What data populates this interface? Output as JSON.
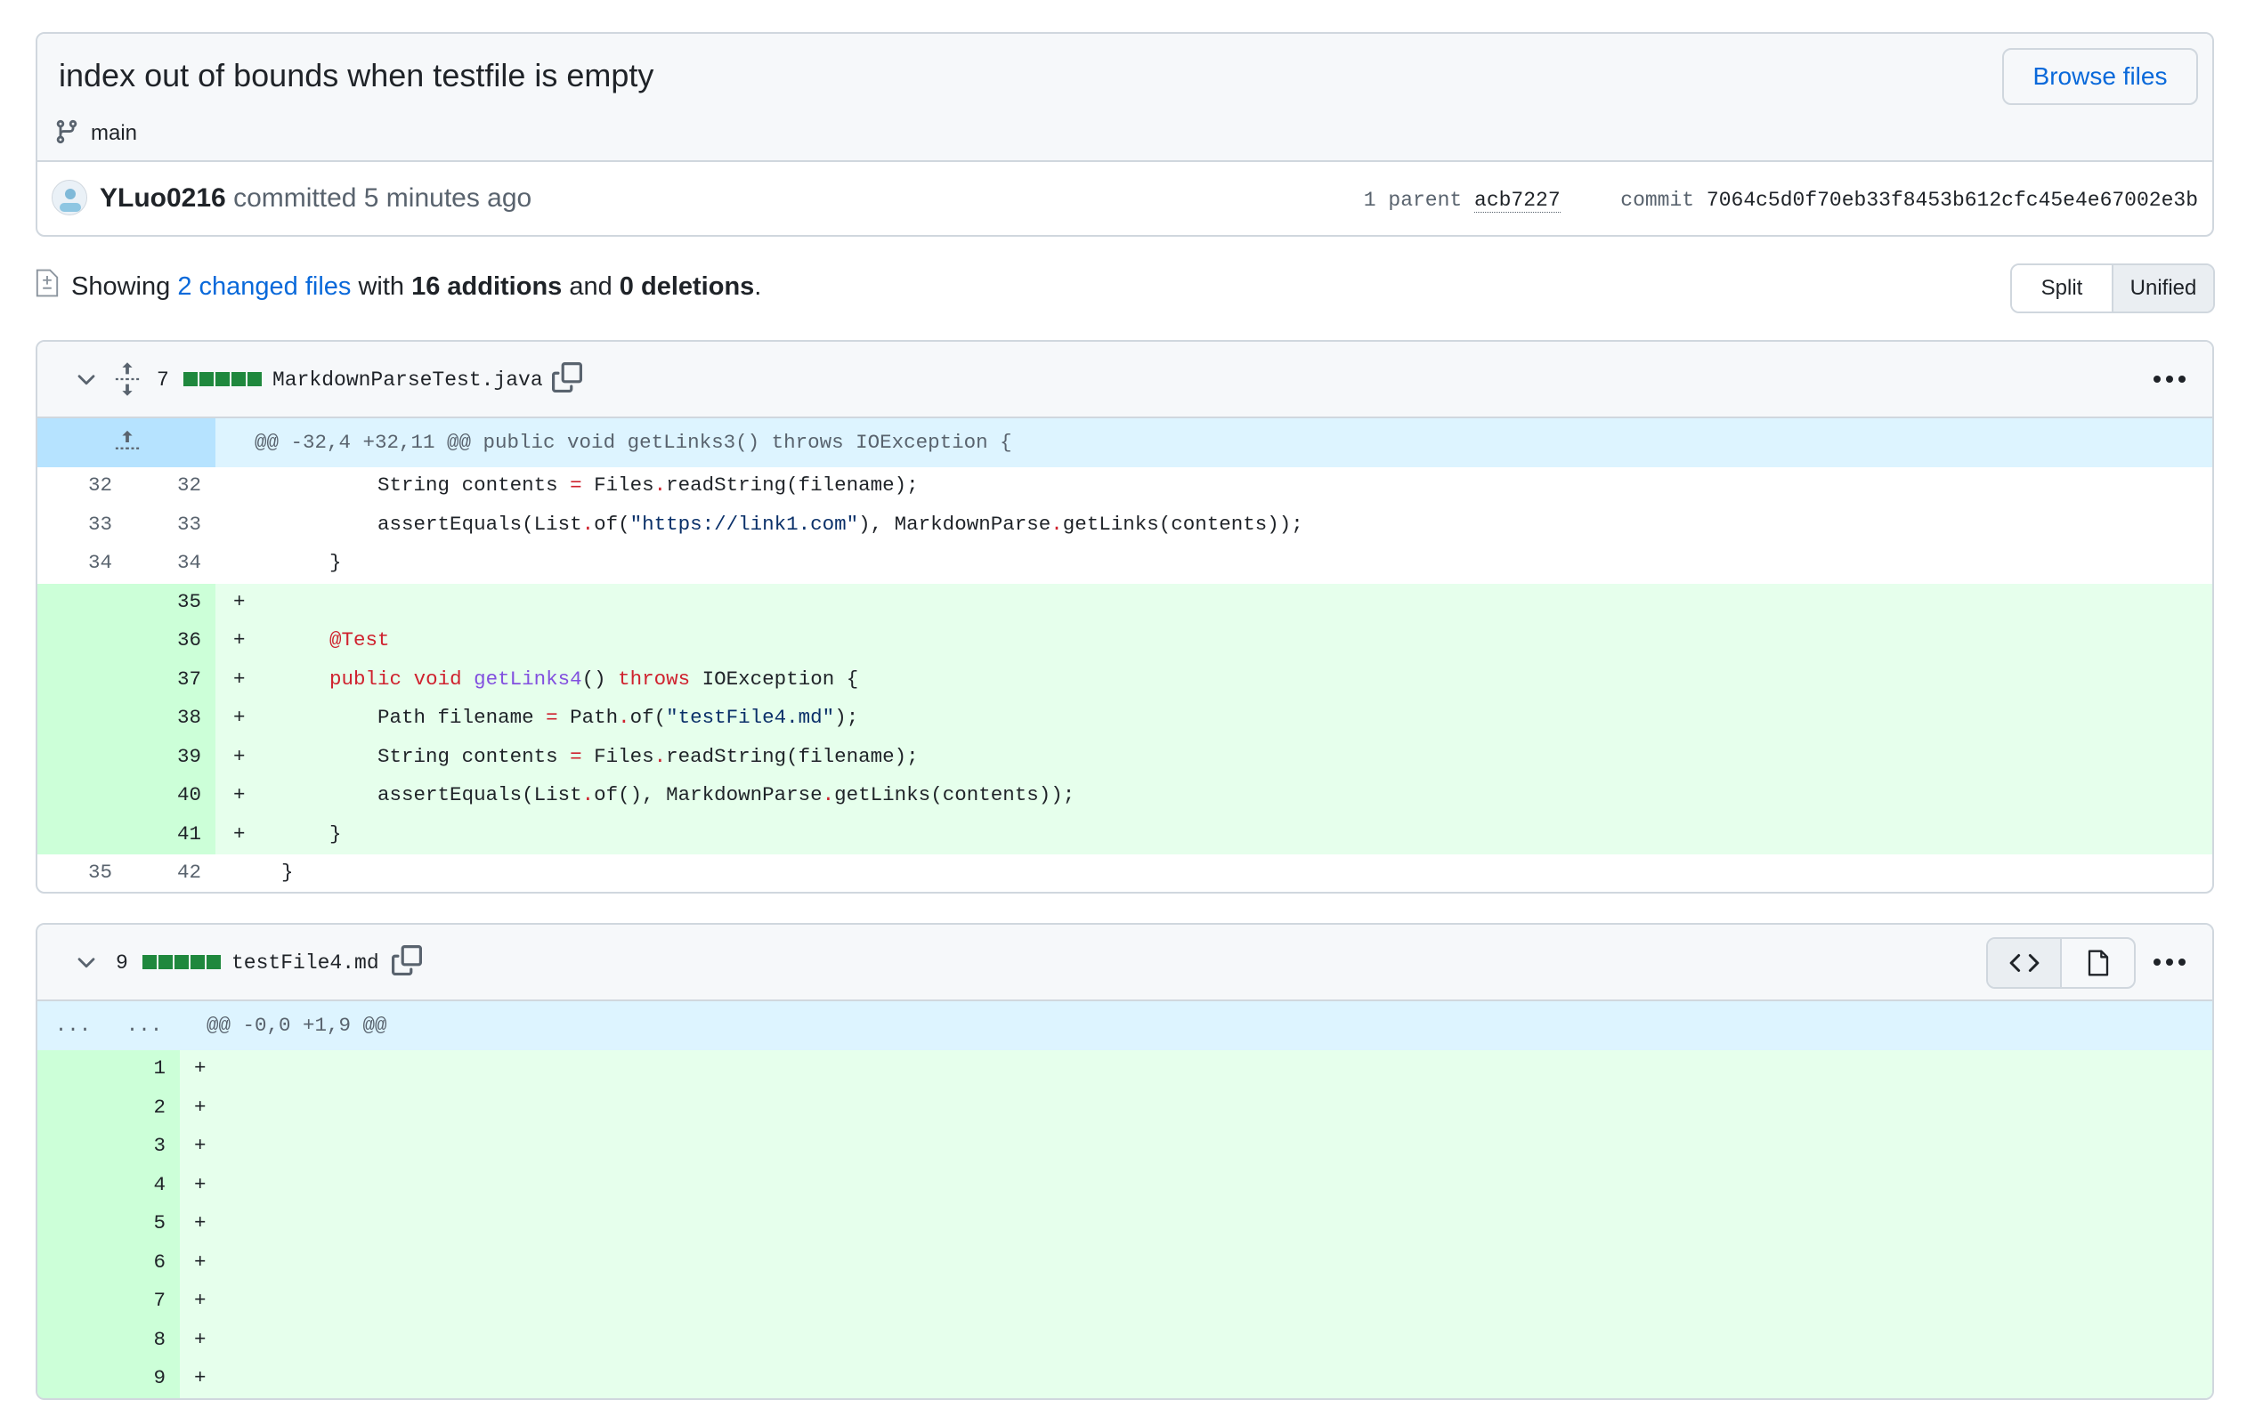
{
  "commit": {
    "title": "index out of bounds when testfile is empty",
    "browse_label": "Browse files",
    "branch": "main",
    "author": "YLuo0216",
    "action_time": " committed 5 minutes ago",
    "parent_label": "1 parent",
    "parent_hash": "acb7227",
    "commit_label": "commit",
    "commit_hash": "7064c5d0f70eb33f8453b612cfc45e4e67002e3b"
  },
  "summary": {
    "prefix": "Showing ",
    "changed_files": "2 changed files",
    "with": " with ",
    "additions": "16 additions",
    "and": " and ",
    "deletions": "0 deletions",
    "suffix": "."
  },
  "view_toggle": {
    "split": "Split",
    "unified": "Unified",
    "selected": "Unified"
  },
  "files": [
    {
      "count": "7",
      "name": "MarkdownParseTest.java",
      "hunk": "@@ -32,4 +32,11 @@ public void getLinks3() throws IOException {",
      "lines": [
        {
          "type": "ctx",
          "old": "32",
          "new": "32",
          "marker": " ",
          "text": "        String contents = Files.readString(filename);"
        },
        {
          "type": "ctx",
          "old": "33",
          "new": "33",
          "marker": " ",
          "text": "        assertEquals(List.of(\"https://link1.com\"), MarkdownParse.getLinks(contents));"
        },
        {
          "type": "ctx",
          "old": "34",
          "new": "34",
          "marker": " ",
          "text": "    }"
        },
        {
          "type": "add",
          "old": "",
          "new": "35",
          "marker": "+",
          "text": ""
        },
        {
          "type": "add",
          "old": "",
          "new": "36",
          "marker": "+",
          "text": "    @Test"
        },
        {
          "type": "add",
          "old": "",
          "new": "37",
          "marker": "+",
          "text": "    public void getLinks4() throws IOException {"
        },
        {
          "type": "add",
          "old": "",
          "new": "38",
          "marker": "+",
          "text": "        Path filename = Path.of(\"testFile4.md\");"
        },
        {
          "type": "add",
          "old": "",
          "new": "39",
          "marker": "+",
          "text": "        String contents = Files.readString(filename);"
        },
        {
          "type": "add",
          "old": "",
          "new": "40",
          "marker": "+",
          "text": "        assertEquals(List.of(), MarkdownParse.getLinks(contents));"
        },
        {
          "type": "add",
          "old": "",
          "new": "41",
          "marker": "+",
          "text": "    }"
        },
        {
          "type": "ctx",
          "old": "35",
          "new": "42",
          "marker": " ",
          "text": "}"
        }
      ]
    },
    {
      "count": "9",
      "name": "testFile4.md",
      "hunk_old": "...",
      "hunk_new": "...",
      "hunk": "@@ -0,0 +1,9 @@",
      "lines": [
        {
          "type": "add",
          "old": "",
          "new": "1",
          "marker": "+",
          "text": ""
        },
        {
          "type": "add",
          "old": "",
          "new": "2",
          "marker": "+",
          "text": ""
        },
        {
          "type": "add",
          "old": "",
          "new": "3",
          "marker": "+",
          "text": ""
        },
        {
          "type": "add",
          "old": "",
          "new": "4",
          "marker": "+",
          "text": ""
        },
        {
          "type": "add",
          "old": "",
          "new": "5",
          "marker": "+",
          "text": ""
        },
        {
          "type": "add",
          "old": "",
          "new": "6",
          "marker": "+",
          "text": ""
        },
        {
          "type": "add",
          "old": "",
          "new": "7",
          "marker": "+",
          "text": ""
        },
        {
          "type": "add",
          "old": "",
          "new": "8",
          "marker": "+",
          "text": ""
        },
        {
          "type": "add",
          "old": "",
          "new": "9",
          "marker": "+",
          "text": ""
        }
      ]
    }
  ],
  "icons": {
    "branch": "git-branch-icon",
    "diff": "file-diff-icon",
    "chevron": "chevron-down-icon",
    "expand": "unfold-icon",
    "copy": "copy-icon",
    "kebab": "kebab-horizontal-icon",
    "code": "code-icon",
    "file": "file-icon",
    "hunk_expand": "fold-up-icon"
  },
  "colors": {
    "link": "#0969da",
    "addition_bg": "#e6ffec",
    "addition_gutter": "#ccffd8",
    "hunk_bg": "#ddf4ff",
    "diffstat_green": "#1f883d",
    "keyword": "#cf222e",
    "string": "#0a3069",
    "function": "#8250df"
  }
}
